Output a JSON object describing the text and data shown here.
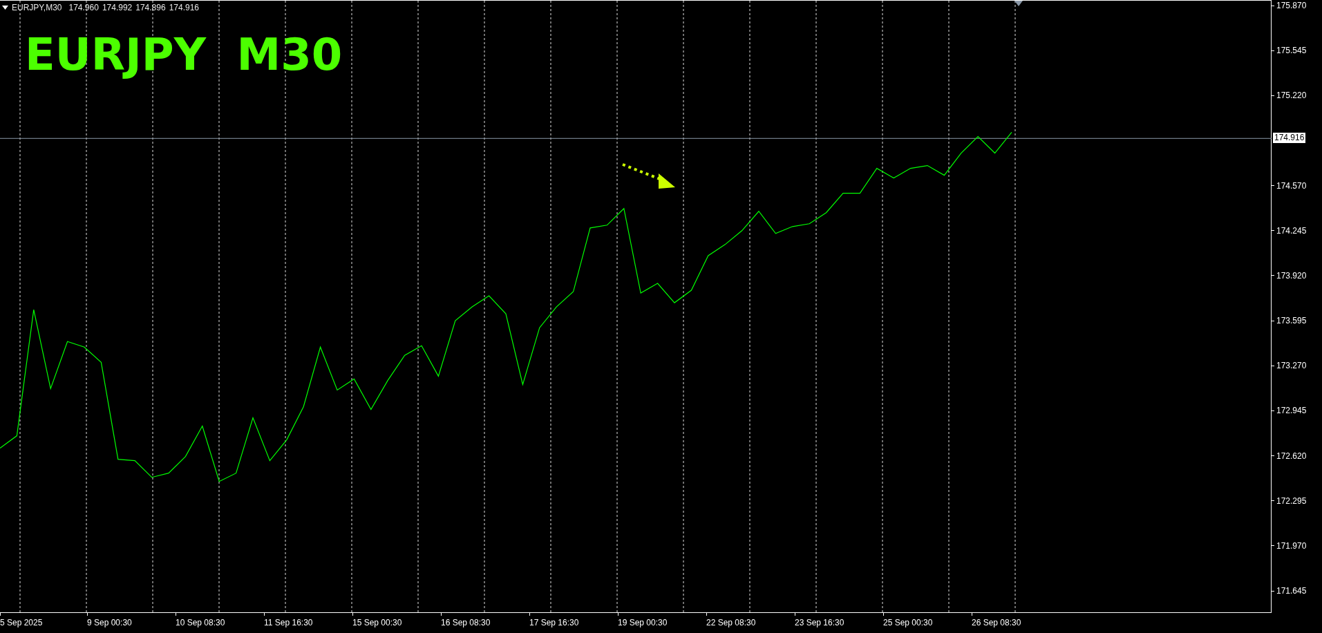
{
  "header": {
    "symbol": "EURJPY,M30",
    "quotes": [
      "174.960",
      "174.992",
      "174.896",
      "174.916"
    ]
  },
  "title": "EURJPY  M30",
  "current_price": "174.916",
  "time_labels": [
    "5 Sep 2025",
    "9 Sep 00:30",
    "10 Sep 08:30",
    "11 Sep 16:30",
    "15 Sep 00:30",
    "16 Sep 08:30",
    "17 Sep 16:30",
    "19 Sep 00:30",
    "22 Sep 08:30",
    "23 Sep 16:30",
    "25 Sep 00:30",
    "26 Sep 08:30"
  ],
  "chart": {
    "chart_data": {
      "type": "line",
      "ylim": [
        171.486,
        175.91
      ],
      "grid": true,
      "ref_lines": [
        {
          "axis": "y",
          "value": 174.916
        }
      ],
      "yticks": [
        {
          "value": 171.645,
          "label": "171.645"
        },
        {
          "value": 171.97,
          "label": "171.970"
        },
        {
          "value": 172.295,
          "label": "172.295"
        },
        {
          "value": 172.62,
          "label": "172.620"
        },
        {
          "value": 172.945,
          "label": "172.945"
        },
        {
          "value": 173.27,
          "label": "173.270"
        },
        {
          "value": 173.595,
          "label": "173.595"
        },
        {
          "value": 173.92,
          "label": "173.920"
        },
        {
          "value": 174.245,
          "label": "174.245"
        },
        {
          "value": 174.57,
          "label": "174.570"
        },
        {
          "value": 175.22,
          "label": "175.220"
        },
        {
          "value": 175.545,
          "label": "175.545"
        },
        {
          "value": 175.87,
          "label": "175.870"
        }
      ],
      "series": [
        {
          "color": "#00ff00",
          "values": [
            172.68,
            172.77,
            173.68,
            173.11,
            173.45,
            173.41,
            173.3,
            172.6,
            172.59,
            172.47,
            172.5,
            172.62,
            172.84,
            172.44,
            172.5,
            172.9,
            172.59,
            172.74,
            172.98,
            173.41,
            173.1,
            173.18,
            172.96,
            173.17,
            173.35,
            173.42,
            173.2,
            173.6,
            173.7,
            173.78,
            173.65,
            173.14,
            173.55,
            173.7,
            173.81,
            174.27,
            174.29,
            174.41,
            173.8,
            173.87,
            173.73,
            173.82,
            174.07,
            174.15,
            174.25,
            174.39,
            174.23,
            174.28,
            174.3,
            174.38,
            174.52,
            174.52,
            174.7,
            174.63,
            174.7,
            174.72,
            174.65,
            174.81,
            174.93,
            174.81,
            174.96
          ]
        }
      ]
    }
  }
}
